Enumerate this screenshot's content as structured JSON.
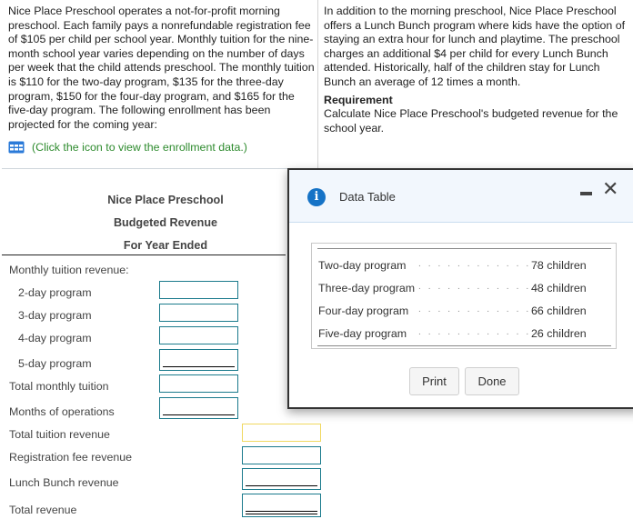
{
  "problem": {
    "left_paragraph": "Nice Place Preschool operates a not-for-profit morning preschool. Each family pays a nonrefundable registration fee of $105 per child per school year. Monthly tuition for the nine-month school year varies depending on the number of days per week that the child attends preschool. The monthly tuition is $110 for the two-day program, $135 for the three-day program, $150 for the four-day program, and $165 for the five-day program. The following enrollment has been projected for the coming year:",
    "right_paragraph": "In addition to the morning preschool, Nice Place Preschool offers a Lunch Bunch program where kids have the option of staying an extra hour for lunch and playtime. The preschool charges an additional $4 per child for every Lunch Bunch attended. Historically, half of the children stay for Lunch Bunch an average of 12 times a month.",
    "requirement_title": "Requirement",
    "requirement_text": "Calculate Nice Place Preschool's budgeted revenue for the school year.",
    "data_link": "(Click the icon to view the enrollment data.)",
    "data_link_icon": "table-grid-icon",
    "link_color": "#2e8b2e"
  },
  "report": {
    "company": "Nice Place Preschool",
    "title": "Budgeted Revenue",
    "period": "For Year Ended",
    "rows": [
      {
        "label": "Monthly tuition revenue:",
        "value": ""
      },
      {
        "label": "2-day program",
        "value": ""
      },
      {
        "label": "3-day program",
        "value": ""
      },
      {
        "label": "4-day program",
        "value": ""
      },
      {
        "label": "5-day program",
        "value": ""
      },
      {
        "label": "Total monthly tuition",
        "value": ""
      },
      {
        "label": "Months of operations",
        "value": ""
      },
      {
        "label": "Total tuition revenue",
        "value": ""
      },
      {
        "label": "Registration fee revenue",
        "value": ""
      },
      {
        "label": "Lunch Bunch revenue",
        "value": ""
      },
      {
        "label": "Total revenue",
        "value": ""
      }
    ],
    "input_border_color": "#1a7a8c",
    "focused_input_border_color": "#f0d860"
  },
  "modal": {
    "title": "Data Table",
    "icon": "info-icon",
    "header_bg": "#f2f7fd",
    "rows": [
      {
        "program": "Two-day program",
        "enrollment": "78 children"
      },
      {
        "program": "Three-day program",
        "enrollment": "48 children"
      },
      {
        "program": "Four-day program",
        "enrollment": "66 children"
      },
      {
        "program": "Five-day program",
        "enrollment": "26 children"
      }
    ],
    "dots": ". . . . . . . . . . . . .",
    "print_label": "Print",
    "done_label": "Done"
  }
}
